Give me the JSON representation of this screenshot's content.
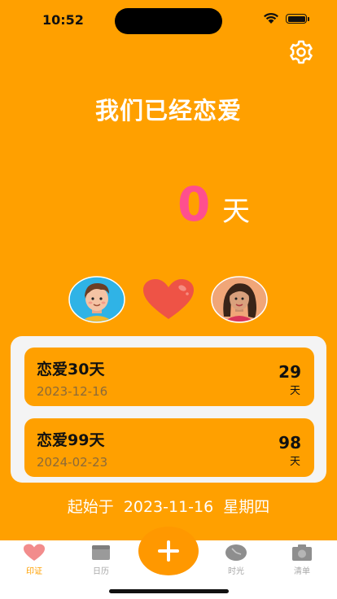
{
  "status_bar": {
    "time": "10:52"
  },
  "header": {
    "title": "我们已经恋爱"
  },
  "counter": {
    "days": "0",
    "unit": "天"
  },
  "anniversaries": [
    {
      "title": "恋爱30天",
      "date": "2023-12-16",
      "days_left": "29",
      "unit": "天"
    },
    {
      "title": "恋爱99天",
      "date": "2024-02-23",
      "days_left": "98",
      "unit": "天"
    }
  ],
  "start": {
    "prefix": "起始于",
    "date": "2023-11-16",
    "weekday": "星期四"
  },
  "tabs": [
    {
      "label": "印证",
      "icon": "heart-icon",
      "active": true
    },
    {
      "label": "日历",
      "icon": "calendar-icon",
      "active": false
    },
    {
      "label": "时光",
      "icon": "clock-icon",
      "active": false
    },
    {
      "label": "清单",
      "icon": "camera-icon",
      "active": false
    }
  ],
  "colors": {
    "background": "#FFA000",
    "accent": "#FF4F8E",
    "panel": "#F4F4F4",
    "tab_active": "#FFA000",
    "tab_inactive": "#A8A8A8"
  }
}
